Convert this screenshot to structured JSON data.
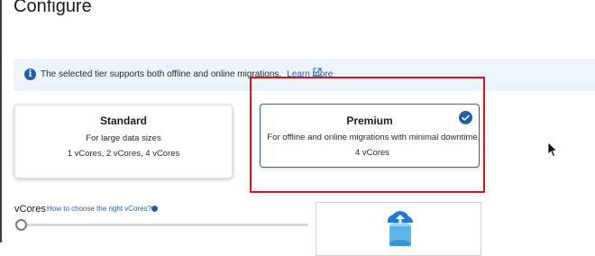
{
  "page": {
    "title": "Configure"
  },
  "info_bar": {
    "text": "The selected tier supports both offline and online migrations.",
    "link": "Learn more"
  },
  "tiers": {
    "standard": {
      "name": "Standard",
      "description": "For large data sizes",
      "cores": "1 vCores, 2 vCores, 4 vCores"
    },
    "premium": {
      "name": "Premium",
      "description": "For offline and online migrations with minimal downtime",
      "cores": "4 vCores",
      "selected": true
    }
  },
  "vcores": {
    "label": "vCores",
    "help_link": "How to choose the right vCores?",
    "slider_value_fraction": 0.0
  },
  "icons": {
    "info": "info-icon",
    "external_link": "external-link-icon",
    "selected": "checkmark-circle-icon",
    "help": "help-icon",
    "upload_storage": "cloud-upload-storage-icon",
    "cursor": "mouse-pointer-icon"
  },
  "colors": {
    "accent": "#1f5fa9",
    "info_background": "#eef4fb",
    "highlight": "#e0101b"
  }
}
